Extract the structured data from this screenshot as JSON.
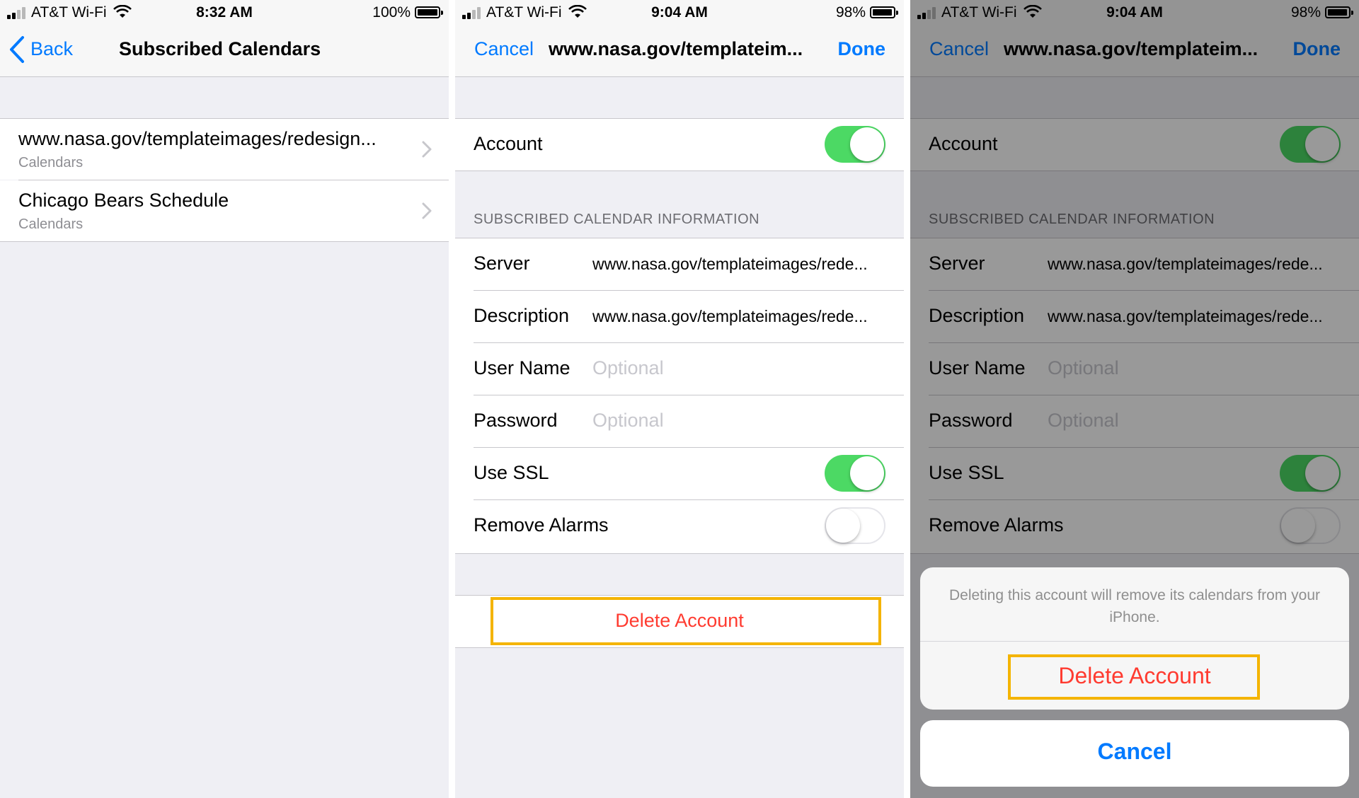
{
  "colors": {
    "accent": "#007aff",
    "destructive": "#ff3b30",
    "toggle_on": "#4cd964",
    "highlight": "#f4b400",
    "background": "#efeff4"
  },
  "panel1": {
    "status": {
      "carrier": "AT&T Wi-Fi",
      "time": "8:32 AM",
      "battery": "100%",
      "battery_level": 1.0
    },
    "nav": {
      "back_label": "Back",
      "title": "Subscribed Calendars"
    },
    "calendars": [
      {
        "title": "www.nasa.gov/templateimages/redesign...",
        "subtitle": "Calendars"
      },
      {
        "title": "Chicago Bears Schedule",
        "subtitle": "Calendars"
      }
    ]
  },
  "panel2": {
    "status": {
      "carrier": "AT&T Wi-Fi",
      "time": "9:04 AM",
      "battery": "98%",
      "battery_level": 0.98
    },
    "nav": {
      "cancel_label": "Cancel",
      "title": "www.nasa.gov/templateim...",
      "done_label": "Done"
    },
    "account": {
      "label": "Account",
      "enabled": true
    },
    "section_header": "SUBSCRIBED CALENDAR INFORMATION",
    "fields": {
      "server_label": "Server",
      "server_value": "www.nasa.gov/templateimages/rede...",
      "description_label": "Description",
      "description_value": "www.nasa.gov/templateimages/rede...",
      "username_label": "User Name",
      "username_placeholder": "Optional",
      "password_label": "Password",
      "password_placeholder": "Optional",
      "ssl_label": "Use SSL",
      "ssl_enabled": true,
      "alarms_label": "Remove Alarms",
      "alarms_enabled": false
    },
    "delete_label": "Delete Account"
  },
  "panel3": {
    "status": {
      "carrier": "AT&T Wi-Fi",
      "time": "9:04 AM",
      "battery": "98%",
      "battery_level": 0.98
    },
    "nav": {
      "cancel_label": "Cancel",
      "title": "www.nasa.gov/templateim...",
      "done_label": "Done"
    },
    "account": {
      "label": "Account",
      "enabled": true
    },
    "section_header": "SUBSCRIBED CALENDAR INFORMATION",
    "fields": {
      "server_label": "Server",
      "server_value": "www.nasa.gov/templateimages/rede...",
      "description_label": "Description",
      "description_value": "www.nasa.gov/templateimages/rede...",
      "username_label": "User Name",
      "username_placeholder": "Optional",
      "password_label": "Password",
      "password_placeholder": "Optional",
      "ssl_label": "Use SSL",
      "ssl_enabled": true,
      "alarms_label": "Remove Alarms",
      "alarms_enabled": false
    },
    "action_sheet": {
      "message": "Deleting this account will remove its calendars from your iPhone.",
      "delete_label": "Delete Account",
      "cancel_label": "Cancel"
    }
  }
}
